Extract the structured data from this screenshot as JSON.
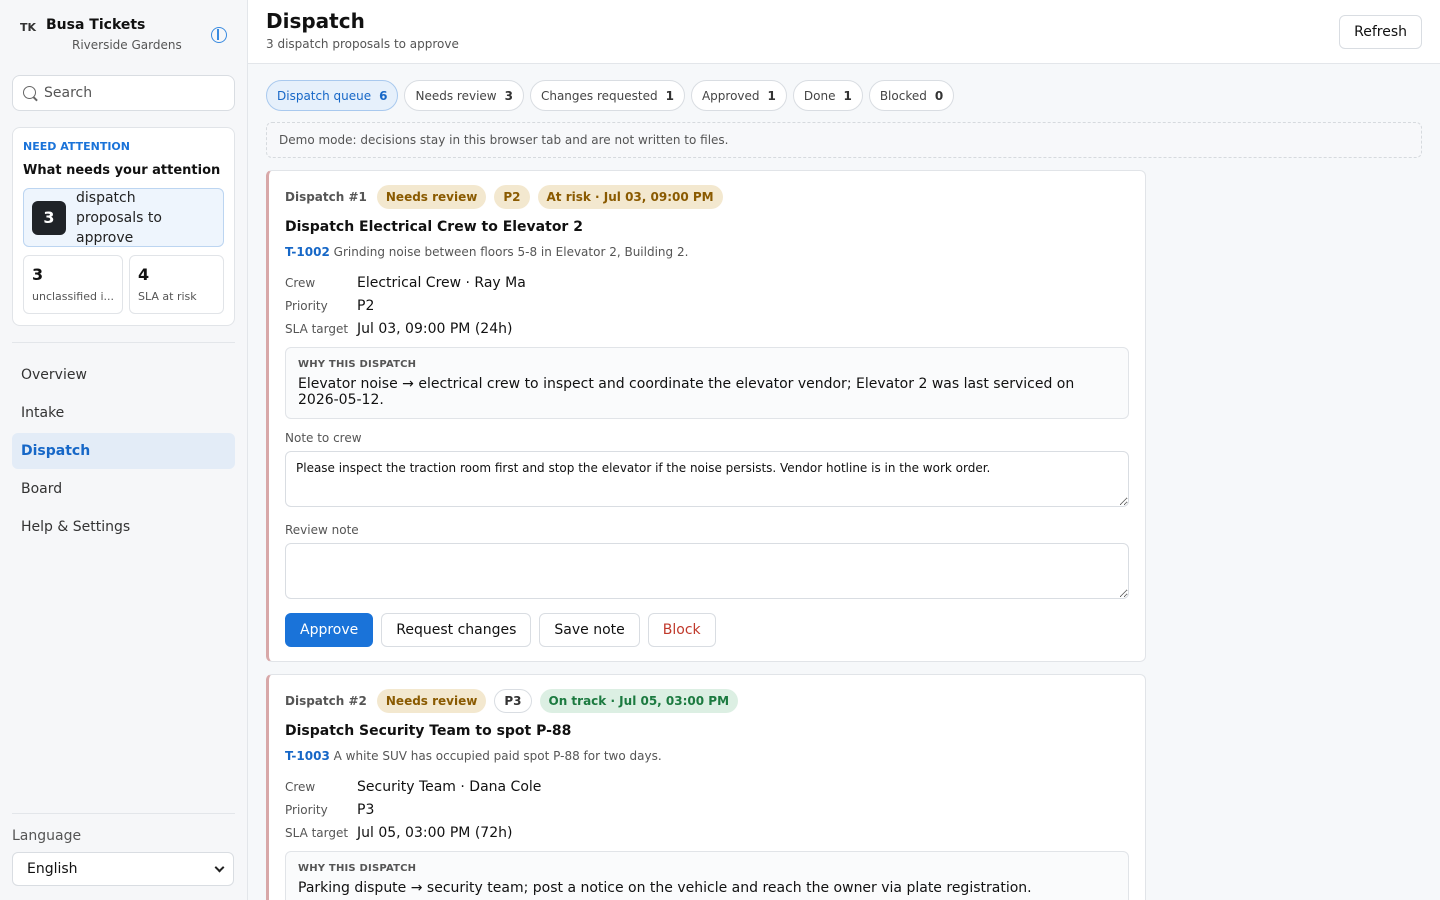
{
  "brand": {
    "badge": "TK",
    "title": "Busa Tickets",
    "subtitle": "Riverside Gardens"
  },
  "search": {
    "placeholder": "Search"
  },
  "attention": {
    "kicker": "NEED ATTENTION",
    "title": "What needs your attention",
    "main_count": "3",
    "main_label": "dispatch proposals to approve",
    "stats": [
      {
        "count": "3",
        "label": "unclassified i..."
      },
      {
        "count": "4",
        "label": "SLA at risk"
      }
    ]
  },
  "nav": {
    "items": [
      {
        "label": "Overview"
      },
      {
        "label": "Intake"
      },
      {
        "label": "Dispatch"
      },
      {
        "label": "Board"
      },
      {
        "label": "Help & Settings"
      }
    ],
    "active": "Dispatch"
  },
  "language": {
    "label": "Language",
    "value": "English"
  },
  "header": {
    "title": "Dispatch",
    "subtitle": "3 dispatch proposals to approve",
    "refresh_label": "Refresh"
  },
  "tabs": [
    {
      "label": "Dispatch queue",
      "count": "6"
    },
    {
      "label": "Needs review",
      "count": "3"
    },
    {
      "label": "Changes requested",
      "count": "1"
    },
    {
      "label": "Approved",
      "count": "1"
    },
    {
      "label": "Done",
      "count": "1"
    },
    {
      "label": "Blocked",
      "count": "0"
    }
  ],
  "demo_notice": "Demo mode: decisions stay in this browser tab and are not written to files.",
  "field_labels": {
    "crew": "Crew",
    "priority": "Priority",
    "sla": "SLA target"
  },
  "why_label": "WHY THIS DISPATCH",
  "note_to_crew_label": "Note to crew",
  "review_note_label": "Review note",
  "action_labels": {
    "approve": "Approve",
    "request_changes": "Request changes",
    "save_note": "Save note",
    "block": "Block"
  },
  "cards": [
    {
      "id": "Dispatch #1",
      "status": "Needs review",
      "priority_badge": "P2",
      "sla_badge": "At risk · Jul 03, 09:00 PM",
      "title": "Dispatch Electrical Crew to Elevator 2",
      "ticket": "T-1002",
      "ticket_desc": "Grinding noise between floors 5-8 in Elevator 2, Building 2.",
      "crew": "Electrical Crew · Ray Ma",
      "priority": "P2",
      "sla": "Jul 03, 09:00 PM (24h)",
      "why": "Elevator noise → electrical crew to inspect and coordinate the elevator vendor; Elevator 2 was last serviced on 2026-05-12.",
      "note_to_crew": "Please inspect the traction room first and stop the elevator if the noise persists. Vendor hotline is in the work order.",
      "review_note": ""
    },
    {
      "id": "Dispatch #2",
      "status": "Needs review",
      "priority_badge": "P3",
      "sla_badge": "On track · Jul 05, 03:00 PM",
      "title": "Dispatch Security Team to spot P-88",
      "ticket": "T-1003",
      "ticket_desc": "A white SUV has occupied paid spot P-88 for two days.",
      "crew": "Security Team · Dana Cole",
      "priority": "P3",
      "sla": "Jul 05, 03:00 PM (72h)",
      "why": "Parking dispute → security team; post a notice on the vehicle and reach the owner via plate registration."
    }
  ]
}
